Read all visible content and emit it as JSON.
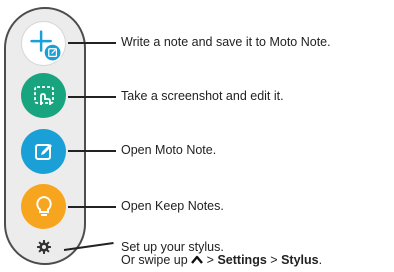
{
  "items": [
    {
      "icon": "add-note-icon",
      "label": "Write a note and save it to Moto Note."
    },
    {
      "icon": "screenshot-edit-icon",
      "label": "Take a screenshot and edit it."
    },
    {
      "icon": "moto-note-icon",
      "label": "Open Moto Note."
    },
    {
      "icon": "lightbulb-icon",
      "label": "Open Keep Notes."
    }
  ],
  "settings": {
    "icon": "gear-icon",
    "line1": "Set up your stylus.",
    "line2_prefix": "Or swipe up",
    "chevron_icon": "chevron-up-icon",
    "separator": ">",
    "settings_label": "Settings",
    "stylus_label": "Stylus",
    "period": "."
  },
  "colors": {
    "panel_bg": "#ececec",
    "panel_border": "#4d4d4d",
    "teal": "#18a47f",
    "blue": "#1a9fd6",
    "orange": "#f7a51f",
    "add_circle": "#ffffff",
    "add_badge": "#1a9fd6"
  }
}
